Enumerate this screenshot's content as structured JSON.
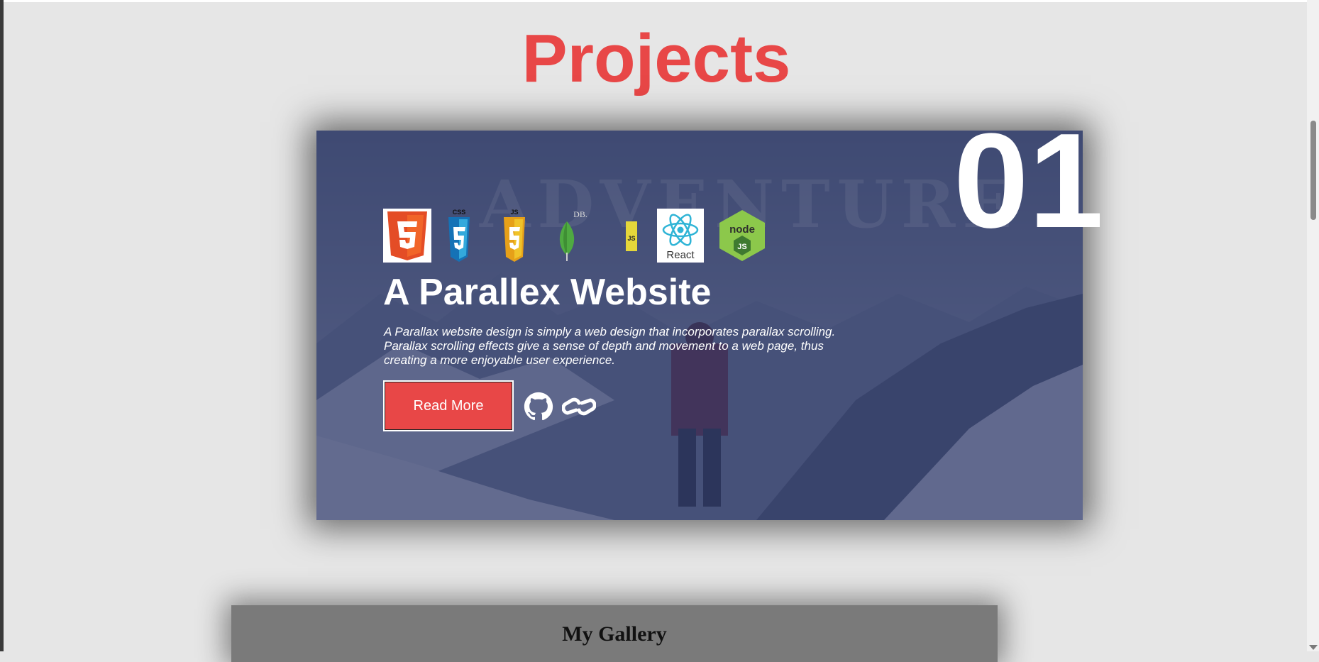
{
  "section": {
    "title": "Projects"
  },
  "project": {
    "number": "01",
    "watermark": "ADVENTURE",
    "title": "A Parallex Website",
    "description": "A Parallax website design is simply a web design that incorporates parallax scrolling. Parallax scrolling effects give a sense of depth and movement to a web page, thus creating a more enjoyable user experience.",
    "read_more_label": "Read More",
    "tech_icons": [
      "html5-icon",
      "css3-icon",
      "javascript-icon",
      "mongodb-icon",
      "expressjs-icon",
      "react-icon",
      "nodejs-icon"
    ],
    "tech_labels": {
      "css": "CSS",
      "js": "JS",
      "mongo": "DB.",
      "react": "React",
      "node": "node",
      "node_js": "JS"
    },
    "links": [
      "github-icon",
      "link-icon"
    ]
  },
  "gallery": {
    "title": "My Gallery"
  },
  "colors": {
    "accent": "#e84747",
    "card_overlay": "#2d3868",
    "page_bg": "#e6e6e6"
  }
}
